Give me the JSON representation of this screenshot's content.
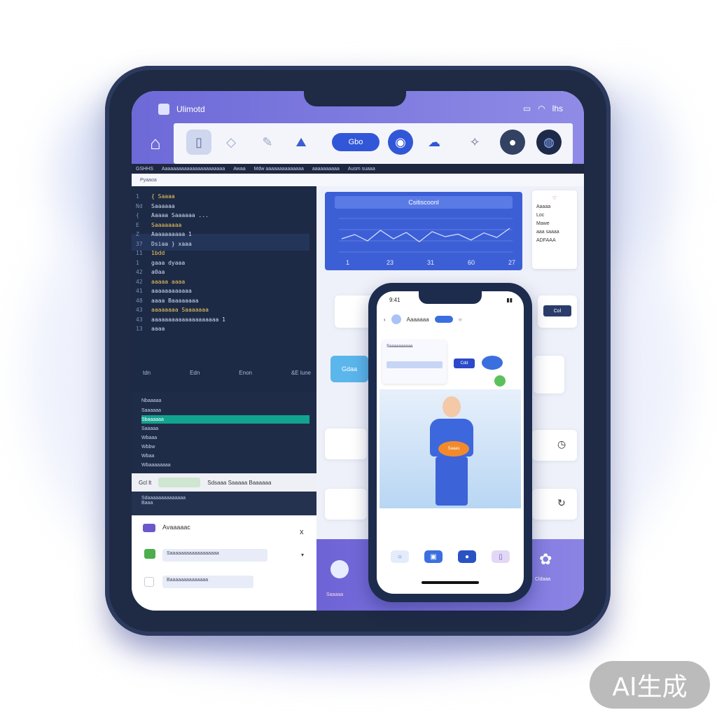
{
  "statusbar": {
    "app_title": "Ulimotd",
    "signal_text": "lhs"
  },
  "toolbar": {
    "primary_pill": "Gbo"
  },
  "menubar": {
    "items": [
      "GSHHS",
      "Aaaaaaaaaaaaaaaaaaaaaaa",
      "Awaa",
      "Mdw aaaaaaaaaaaaaa",
      "aaaaaaaaaa",
      "Ausm suaaa"
    ]
  },
  "path": "Pyaaoa",
  "editor": {
    "lines": [
      {
        "n": "1",
        "code": "{ Saaaa"
      },
      {
        "n": "Nd",
        "code": "Saaaaaa"
      },
      {
        "n": "{",
        "code": "Aaaaa   Saaaaaa  ..."
      },
      {
        "n": "E",
        "code": "Saaaaaaaa"
      },
      {
        "n": "Z",
        "code": "Aaaaaaaaaa  1"
      },
      {
        "n": "37",
        "code": "Dsiaa  } xaaa"
      },
      {
        "n": "11",
        "code": "1bdd"
      },
      {
        "n": "1",
        "code": "gaaa  dyaaa"
      },
      {
        "n": "42",
        "code": "a0aa"
      },
      {
        "n": "42",
        "code": "aaaaa  aaaa"
      },
      {
        "n": "41",
        "code": "aaaaaaaaaaaa"
      },
      {
        "n": "48",
        "code": "aaaa  Baaaaaaaa"
      },
      {
        "n": "43",
        "code": "aaaaaaaa  Saaaaaaa"
      },
      {
        "n": "43",
        "code": "aaaaaaaaaaaaaaaaaaaa  1"
      },
      {
        "n": "13",
        "code": "aaaa"
      }
    ],
    "columns": [
      "tdn",
      "Edn",
      "Enon",
      "&E  lune"
    ]
  },
  "tree": {
    "header": "Nbaaaaa",
    "items": [
      "Saaaaaa",
      "Sbaaaaaa",
      "Saaaaa",
      "Wbaaa",
      "Wbbw",
      "Wbaa",
      "Wbaaaaaaaa"
    ]
  },
  "console": {
    "tab": "Gcl lt",
    "actions": "Sdsaaa   Saaaaa  Baaaaaa"
  },
  "output": {
    "line1": "Sdaaaaaaaaaaaaaa",
    "line2": "Baaa"
  },
  "dialog": {
    "title": "Avaaaaac",
    "close": "x",
    "field1": "Saaaaaaaaaaaaaaaaaa",
    "field2": "Baaaaaaaaaaaaaa"
  },
  "chart_card": {
    "header": "Csitiscoonl",
    "x_ticks": [
      "1",
      "23",
      "31",
      "60",
      "27"
    ]
  },
  "side_card": {
    "lines": [
      "Aaaaa",
      "Loc",
      "Mawe",
      "aaa saaaa",
      "ADFAAA"
    ]
  },
  "blue_button": "Gdaa",
  "right_button": "Col",
  "phone": {
    "time": "9:41",
    "nav_title": "Aaaaaaa",
    "card_title": "Saaaaaaaaaa",
    "card_button": "Cdd",
    "badge": "Saaas"
  },
  "bottom_left": {
    "label": "Saaaaa"
  },
  "bottom_right": {
    "label": "Cldaaa"
  },
  "watermark": "AI生成",
  "colors": {
    "accent": "#6d6ad8",
    "editor_bg": "#1d2a45",
    "primary_blue": "#3157d8",
    "device_frame": "#1f2a45"
  }
}
